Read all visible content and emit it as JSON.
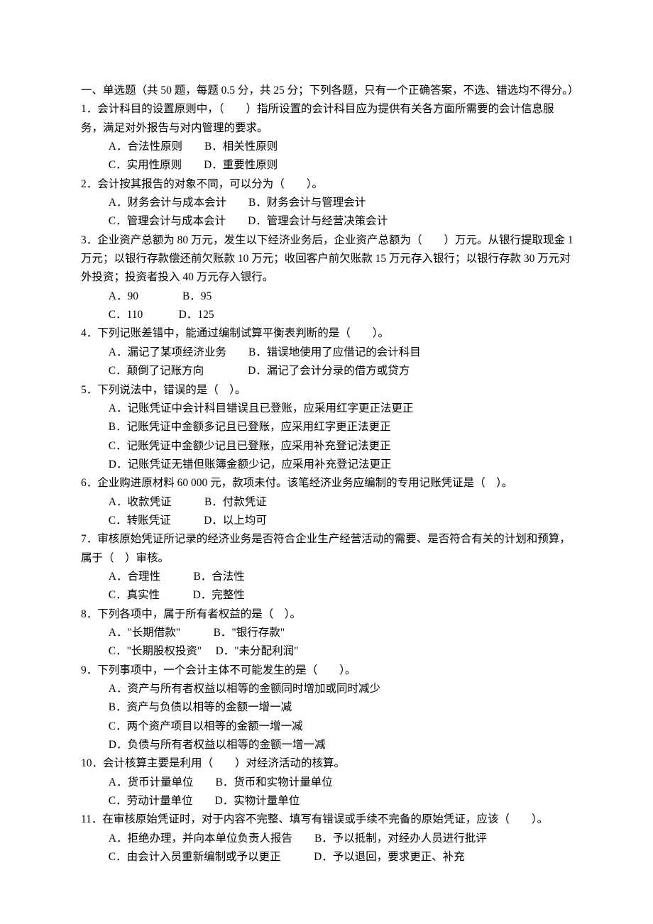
{
  "instructions": "一、单选题（共 50 题，每题 0.5 分，共 25 分；下列各题，只有一个正确答案，不选、错选均不得分。）",
  "questions": [
    {
      "num": "1．",
      "text": "会计科目的设置原则中，（　　）指所设置的会计科目应为提供有关各方面所需要的会计信息服务，满足对外报告与对内管理的要求。",
      "optionRows": [
        "A．合法性原则　　B．相关性原则",
        "C．实用性原则　　D．重要性原则"
      ]
    },
    {
      "num": "2．",
      "text": "会计按其报告的对象不同，可以分为（　　）。",
      "optionRows": [
        "A．财务会计与成本会计　　B．财务会计与管理会计",
        "C．管理会计与成本会计　　D．管理会计与经营决策会计"
      ]
    },
    {
      "num": "3．",
      "text": "企业资产总额为 80 万元，发生以下经济业务后，企业资产总额为（　　）万元。从银行提取现金 1 万元；以银行存款偿还前欠账款 10 万元；收回客户前欠账款 15 万元存入银行；以银行存款 30 万元对外投资；投资者投入 40 万元存入银行。",
      "optionRows": [
        "A．90　　　　B．95",
        "C．110　　　 D．125"
      ]
    },
    {
      "num": "4．",
      "text": "下列记账差错中，能通过编制试算平衡表判断的是（　　）。",
      "optionRows": [
        "A．漏记了某项经济业务　　B．错误地使用了应借记的会计科目",
        "C．颠倒了记账方向　　　　D．漏记了会计分录的借方或贷方"
      ]
    },
    {
      "num": "5．",
      "text": "下列说法中，错误的是（　）。",
      "optionRows": [
        "A．记账凭证中会计科目错误且已登账，应采用红字更正法更正",
        "B．记账凭证中金额多记且已登账，应采用红字更正法更正",
        "C．记账凭证中金额少记且已登账，应采用补充登记法更正",
        "D．记账凭证无错但账簿金额少记，应采用补充登记法更正"
      ]
    },
    {
      "num": "6．",
      "text": "企业购进原材料 60 000 元，款项未付。该笔经济业务应编制的专用记账凭证是（　）。",
      "optionRows": [
        "A．收款凭证　　　B．付款凭证",
        "C．转账凭证　　　D．以上均可"
      ]
    },
    {
      "num": "7．",
      "text": "审核原始凭证所记录的经济业务是否符合企业生产经营活动的需要、是否符合有关的计划和预算，属于（　）审核。",
      "optionRows": [
        "A．合理性　　　B．合法性",
        "C．真实性　　　D．完整性"
      ]
    },
    {
      "num": "8．",
      "text": "下列各项中，属于所有者权益的是（　）。",
      "optionRows": [
        "A．\"长期借款\"　　　B．\"银行存款\"",
        "C．\"长期股权投资\"　 D．\"未分配利润\""
      ]
    },
    {
      "num": "9．",
      "text": "下列事项中，一个会计主体不可能发生的是（　　）。",
      "optionRows": [
        "A．资产与所有者权益以相等的金额同时增加或同时减少",
        "B．资产与负债以相等的金额一增一减",
        "C．两个资产项目以相等的金额一增一减",
        "D．负债与所有者权益以相等的金额一增一减"
      ]
    },
    {
      "num": "10．",
      "text": "会计核算主要是利用（　　）对经济活动的核算。",
      "optionRows": [
        "A．货币计量单位　　B．货币和实物计量单位",
        "C．劳动计量单位　　D．实物计量单位"
      ]
    },
    {
      "num": "11．",
      "text": "在审核原始凭证时，对于内容不完整、填写有错误或手续不完备的原始凭证，应该（　　）。",
      "optionRows": [
        "A．拒绝办理，并向本单位负责人报告　　B．予以抵制，对经办人员进行批评",
        "C．由会计入员重新编制或予以更正　　　D．予以退回，要求更正、补充"
      ]
    }
  ]
}
